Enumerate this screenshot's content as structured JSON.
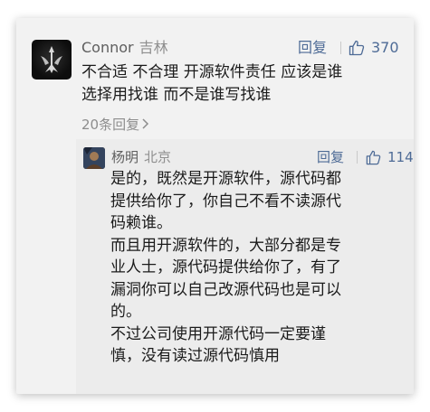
{
  "comment": {
    "username": "Connor",
    "location": "吉林",
    "reply_label": "回复",
    "like_count": "370",
    "content": "不合适 不合理 开源软件责任 应该是谁\n选择用找谁 而不是谁写找谁",
    "replies_link": "20条回复"
  },
  "reply": {
    "username": "杨明",
    "location": "北京",
    "reply_label": "回复",
    "like_count": "114",
    "content": "是的，既然是开源软件，源代码都\n提供给你了，你自己不看不读源代\n码赖谁。\n而且用开源软件的，大部分都是专\n业人士，源代码提供给你了，有了\n漏洞你可以自己改源代码也是可以\n的。\n不过公司使用开源代码一定要谨\n慎，没有读过源代码慎用"
  },
  "icons": {
    "like": "thumbs-up-icon",
    "chevron": "chevron-right-icon"
  },
  "colors": {
    "card_bg": "#f2f2f2",
    "reply_bg": "#ececec",
    "link_blue": "#4e6b96",
    "username_gray": "#5f5f5f",
    "meta_gray": "#8d8d8d",
    "text_dark": "#1b1b1b"
  }
}
